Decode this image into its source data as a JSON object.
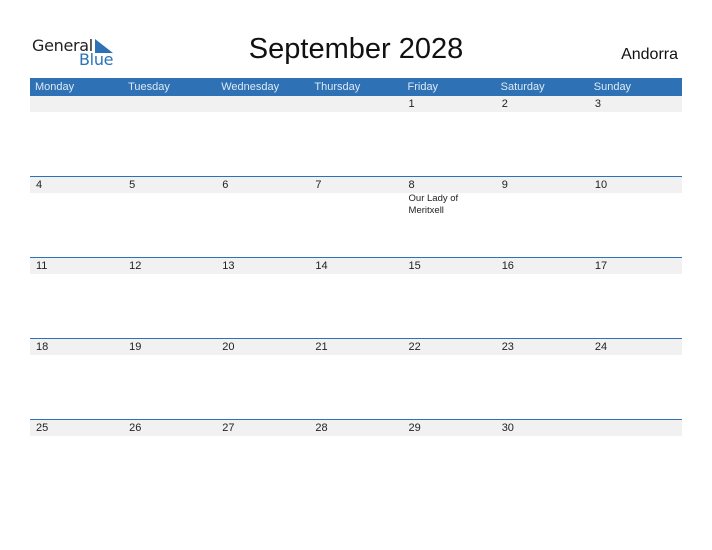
{
  "logo": {
    "text_primary": "General",
    "text_secondary": "Blue",
    "icon": "triangle-flag-icon"
  },
  "title": "September 2028",
  "country": "Andorra",
  "colors": {
    "accent": "#2e72b5",
    "date_strip": "#f1f1f1"
  },
  "weekdays": [
    "Monday",
    "Tuesday",
    "Wednesday",
    "Thursday",
    "Friday",
    "Saturday",
    "Sunday"
  ],
  "weeks": [
    {
      "days": [
        {
          "date": "",
          "event": ""
        },
        {
          "date": "",
          "event": ""
        },
        {
          "date": "",
          "event": ""
        },
        {
          "date": "",
          "event": ""
        },
        {
          "date": "1",
          "event": ""
        },
        {
          "date": "2",
          "event": ""
        },
        {
          "date": "3",
          "event": ""
        }
      ]
    },
    {
      "days": [
        {
          "date": "4",
          "event": ""
        },
        {
          "date": "5",
          "event": ""
        },
        {
          "date": "6",
          "event": ""
        },
        {
          "date": "7",
          "event": ""
        },
        {
          "date": "8",
          "event": "Our Lady of Meritxell"
        },
        {
          "date": "9",
          "event": ""
        },
        {
          "date": "10",
          "event": ""
        }
      ]
    },
    {
      "days": [
        {
          "date": "11",
          "event": ""
        },
        {
          "date": "12",
          "event": ""
        },
        {
          "date": "13",
          "event": ""
        },
        {
          "date": "14",
          "event": ""
        },
        {
          "date": "15",
          "event": ""
        },
        {
          "date": "16",
          "event": ""
        },
        {
          "date": "17",
          "event": ""
        }
      ]
    },
    {
      "days": [
        {
          "date": "18",
          "event": ""
        },
        {
          "date": "19",
          "event": ""
        },
        {
          "date": "20",
          "event": ""
        },
        {
          "date": "21",
          "event": ""
        },
        {
          "date": "22",
          "event": ""
        },
        {
          "date": "23",
          "event": ""
        },
        {
          "date": "24",
          "event": ""
        }
      ]
    },
    {
      "days": [
        {
          "date": "25",
          "event": ""
        },
        {
          "date": "26",
          "event": ""
        },
        {
          "date": "27",
          "event": ""
        },
        {
          "date": "28",
          "event": ""
        },
        {
          "date": "29",
          "event": ""
        },
        {
          "date": "30",
          "event": ""
        },
        {
          "date": "",
          "event": ""
        }
      ]
    }
  ]
}
